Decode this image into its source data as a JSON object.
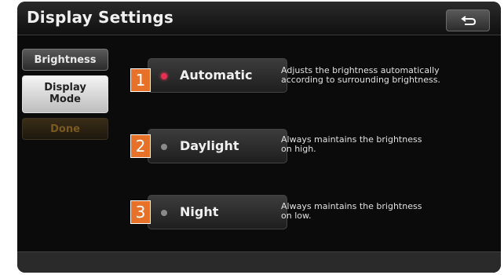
{
  "header": {
    "title": "Display Settings",
    "back_icon": "back-arrow-icon"
  },
  "sidebar": {
    "items": [
      {
        "label": "Brightness"
      },
      {
        "label_line1": "Display",
        "label_line2": "Mode",
        "selected": true
      },
      {
        "label": "Done",
        "enabled": false
      }
    ]
  },
  "options": [
    {
      "number": "1",
      "label": "Automatic",
      "active": true,
      "desc_line1": "Adjusts the brightness automatically",
      "desc_line2": "according to surrounding brightness."
    },
    {
      "number": "2",
      "label": "Daylight",
      "active": false,
      "desc_line1": "Always maintains the brightness",
      "desc_line2": "on high."
    },
    {
      "number": "3",
      "label": "Night",
      "active": false,
      "desc_line1": "Always maintains the brightness",
      "desc_line2": "on low."
    }
  ],
  "colors": {
    "accent_badge": "#e8712a",
    "active_led": "#e83050"
  }
}
